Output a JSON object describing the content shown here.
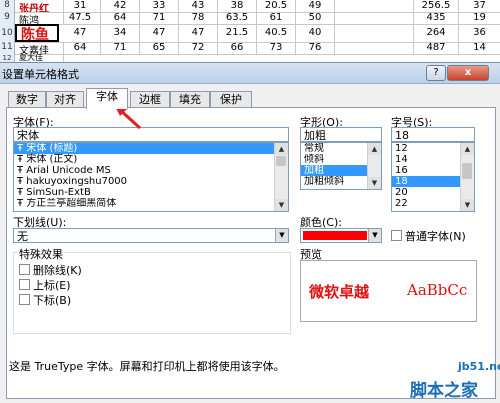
{
  "sheet": {
    "rows": [
      {
        "num": "8",
        "name": "张丹红",
        "name_color": "#c00000",
        "cells": [
          "31",
          "42",
          "33",
          "43",
          "38",
          "20.5",
          "49",
          "",
          "256.5",
          "37"
        ]
      },
      {
        "num": "9",
        "name": "陈鸿",
        "name_color": "#000000",
        "cells": [
          "47.5",
          "64",
          "71",
          "78",
          "63.5",
          "61",
          "50",
          "",
          "435",
          "19"
        ]
      },
      {
        "num": "10",
        "name": "陈鱼",
        "name_color": "#e01010",
        "cells": [
          "47",
          "34",
          "47",
          "47",
          "21.5",
          "40.5",
          "40",
          "",
          "264",
          "36"
        ]
      },
      {
        "num": "11",
        "name": "文嘉佳",
        "name_color": "#000000",
        "cells": [
          "64",
          "71",
          "65",
          "72",
          "66",
          "73",
          "76",
          "",
          "487",
          "14"
        ]
      },
      {
        "num": "12",
        "name": "夏大佳",
        "name_color": "#000000",
        "cells": [
          "",
          "",
          "",
          "",
          "",
          "",
          "",
          "",
          "",
          ""
        ]
      }
    ]
  },
  "dialog": {
    "title": "设置单元格格式",
    "help_label": "?",
    "close_label": "x",
    "tabs": [
      "数字",
      "对齐",
      "字体",
      "边框",
      "填充",
      "保护"
    ],
    "active_tab": "字体",
    "font_label": "字体(F):",
    "font_value": "宋体",
    "font_list": [
      "宋体 (标题)",
      "宋体 (正文)",
      "Arial Unicode MS",
      "hakuyoxingshu7000",
      "SimSun-ExtB",
      "方正兰亭超细黑简体"
    ],
    "font_selected": "宋体 (标题)",
    "style_label": "字形(O):",
    "style_value": "加粗",
    "style_list": [
      "常规",
      "倾斜",
      "加粗",
      "加粗倾斜"
    ],
    "style_selected": "加粗",
    "size_label": "字号(S):",
    "size_value": "18",
    "size_list": [
      "12",
      "14",
      "16",
      "18",
      "20",
      "22"
    ],
    "size_selected": "18",
    "underline_label": "下划线(U):",
    "underline_value": "无",
    "color_label": "颜色(C):",
    "color_value": "#ff0000",
    "normal_font_label": "普通字体(N)",
    "effects_label": "特殊效果",
    "strikethrough_label": "删除线(K)",
    "superscript_label": "上标(E)",
    "subscript_label": "下标(B)",
    "preview_label": "预览",
    "preview_cn": "微软卓越",
    "preview_en": "AaBbCc",
    "preview_color": "#e01010",
    "info_text": "这是 TrueType 字体。屏幕和打印机上都将使用该字体。"
  },
  "watermark": {
    "url": "jb51.net",
    "name": "脚本之家"
  }
}
